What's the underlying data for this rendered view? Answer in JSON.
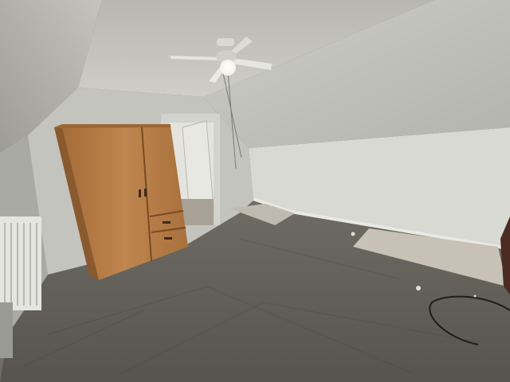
{
  "scene": {
    "description_elements": [
      "sloped-ceiling",
      "ceiling-fan",
      "wardrobe",
      "open-door",
      "radiator",
      "subfloor",
      "floor-patches",
      "loose-cable"
    ],
    "colors": {
      "ceiling": "#c9c8c2",
      "ceiling_shadow": "#9f9e98",
      "wall_right": "#dcdcd6",
      "wall_back": "#d4d5cf",
      "wall_left": "#b9bab4",
      "floor": "#5e5a55",
      "floor_light": "#7a766f",
      "wardrobe": "#b57b45",
      "wardrobe_dark": "#8d5a2d",
      "door_frame": "#cfd0ca",
      "radiator": "#e6e6e2",
      "patch": "#c8c3b6"
    }
  }
}
